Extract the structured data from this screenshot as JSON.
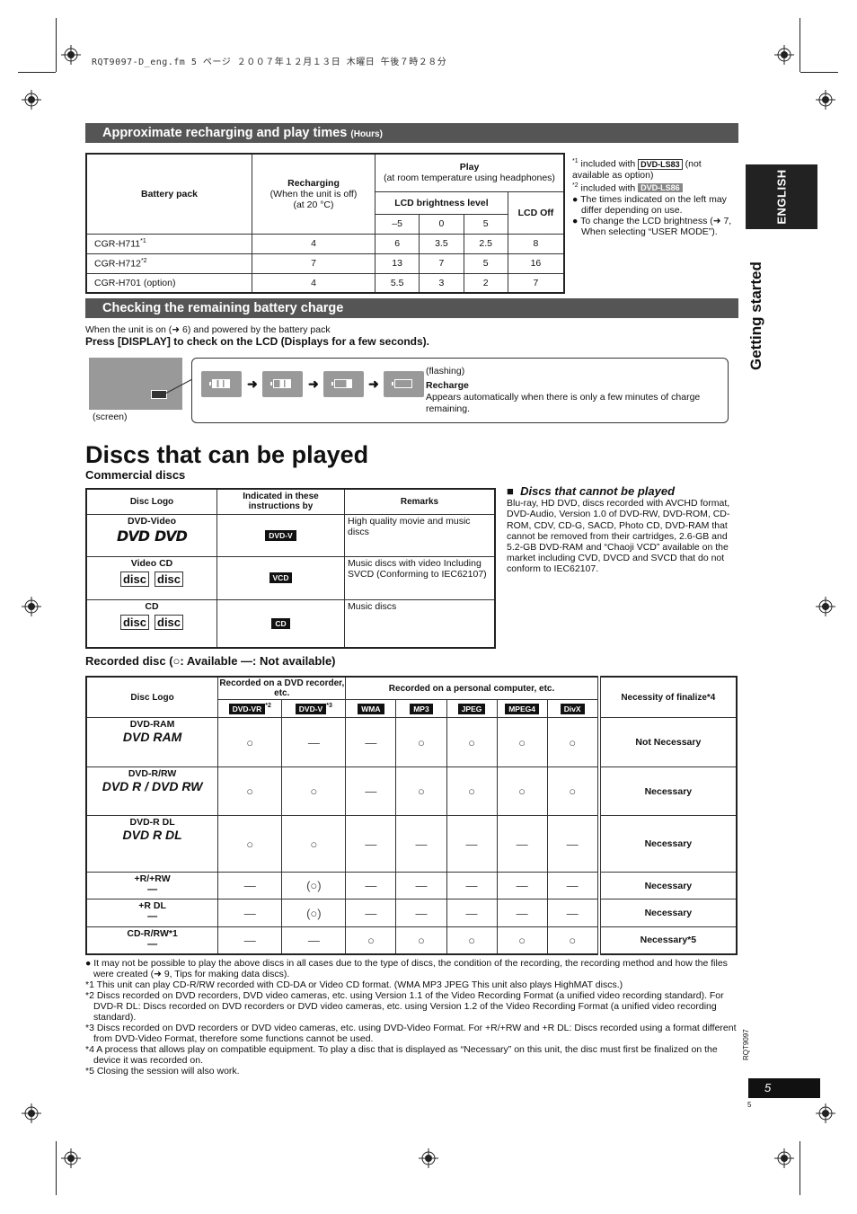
{
  "print_header": "RQT9097-D_eng.fm  5 ページ  ２００７年１２月１３日  木曜日  午後７時２８分",
  "side_tab": {
    "language": "ENGLISH",
    "chapter": "Getting started"
  },
  "section1": {
    "title": "Approximate recharging and play times",
    "title_suffix": "(Hours)",
    "table": {
      "h_battery": "Battery pack",
      "h_recharging": "Recharging",
      "h_recharging_sub1": "(When the unit is off)",
      "h_recharging_sub2": "(at 20 °C)",
      "h_play": "Play",
      "h_play_sub": "(at room temperature using headphones)",
      "h_lcd_level": "LCD brightness level",
      "h_lcd_off": "LCD Off",
      "levels": [
        "–5",
        "0",
        "5"
      ],
      "rows": [
        {
          "pack": "CGR-H711",
          "note": "*1",
          "recharge": "4",
          "m5": "6",
          "z": "3.5",
          "p5": "2.5",
          "off": "8"
        },
        {
          "pack": "CGR-H712",
          "note": "*2",
          "recharge": "7",
          "m5": "13",
          "z": "7",
          "p5": "5",
          "off": "16"
        },
        {
          "pack": "CGR-H701 (option)",
          "note": "",
          "recharge": "4",
          "m5": "5.5",
          "z": "3",
          "p5": "2",
          "off": "7"
        }
      ]
    },
    "notes": {
      "n1_mark": "*1",
      "n1_pre": "included with",
      "n1_badge": "DVD-LS83",
      "n1_post": "(not available as option)",
      "n2_mark": "*2",
      "n2_pre": "included with",
      "n2_badge": "DVD-LS86",
      "b1": "The times indicated on the left may differ depending on use.",
      "b2": "To change the LCD brightness (➜ 7, When selecting “USER MODE”)."
    }
  },
  "section2": {
    "title": "Checking the remaining battery charge",
    "intro": "When the unit is on (➜ 6) and powered by the battery pack",
    "instruction": "Press [DISPLAY] to check on the LCD (Displays for a few seconds).",
    "screen_label": "(screen)",
    "flashing": "(flashing)",
    "recharge_title": "Recharge",
    "recharge_desc": "Appears automatically when there is only a few minutes of charge remaining.",
    "arrow": "➜"
  },
  "discs": {
    "title": "Discs that can be played",
    "commercial_title": "Commercial discs",
    "commercial_headers": {
      "logo": "Disc Logo",
      "indicated": "Indicated in these instructions by",
      "remarks": "Remarks"
    },
    "commercial_rows": [
      {
        "name": "DVD-Video",
        "badge": "DVD-V",
        "remarks": "High quality movie and music discs"
      },
      {
        "name": "Video CD",
        "badge": "VCD",
        "remarks": "Music discs with video Including SVCD (Conforming to IEC62107)"
      },
      {
        "name": "CD",
        "badge": "CD",
        "remarks": "Music discs"
      }
    ],
    "cannot_title": "Discs that cannot be played",
    "cannot_text": "Blu-ray, HD DVD, discs recorded with AVCHD format, DVD-Audio, Version 1.0 of DVD-RW, DVD-ROM, CD-ROM, CDV, CD-G, SACD, Photo CD, DVD-RAM that cannot be removed from their cartridges, 2.6-GB and 5.2-GB DVD-RAM and “Chaoji VCD” available on the market including CVD, DVCD and SVCD that do not conform to IEC62107.",
    "recorded_title": "Recorded disc (○: Available —: Not available)",
    "recorded_headers": {
      "logo": "Disc Logo",
      "dvd_recorder": "Recorded on a DVD recorder, etc.",
      "pc": "Recorded on a personal computer, etc.",
      "finalize": "Necessity of finalize*4",
      "formats": [
        {
          "badge": "DVD-VR",
          "note": "*2"
        },
        {
          "badge": "DVD-V",
          "note": "*3"
        },
        {
          "badge": "WMA",
          "note": ""
        },
        {
          "badge": "MP3",
          "note": ""
        },
        {
          "badge": "JPEG",
          "note": ""
        },
        {
          "badge": "MPEG4",
          "note": ""
        },
        {
          "badge": "DivX",
          "note": ""
        }
      ]
    },
    "recorded_rows": [
      {
        "name": "DVD-RAM",
        "logo": "DVD RAM",
        "cells": [
          "○",
          "—",
          "—",
          "○",
          "○",
          "○",
          "○"
        ],
        "finalize": "Not Necessary"
      },
      {
        "name": "DVD-R/RW",
        "logo": "DVD R / DVD RW",
        "cells": [
          "○",
          "○",
          "—",
          "○",
          "○",
          "○",
          "○"
        ],
        "finalize": "Necessary"
      },
      {
        "name": "DVD-R DL",
        "logo": "DVD R DL",
        "cells": [
          "○",
          "○",
          "—",
          "—",
          "—",
          "—",
          "—"
        ],
        "finalize": "Necessary"
      },
      {
        "name": "+R/+RW",
        "logo": "—",
        "cells": [
          "—",
          "(○)",
          "—",
          "—",
          "—",
          "—",
          "—"
        ],
        "finalize": "Necessary"
      },
      {
        "name": "+R DL",
        "logo": "—",
        "cells": [
          "—",
          "(○)",
          "—",
          "—",
          "—",
          "—",
          "—"
        ],
        "finalize": "Necessary"
      },
      {
        "name": "CD-R/RW*1",
        "logo": "—",
        "cells": [
          "—",
          "—",
          "○",
          "○",
          "○",
          "○",
          "○"
        ],
        "finalize": "Necessary*5"
      }
    ]
  },
  "footnotes": [
    "● It may not be possible to play the above discs in all cases due to the type of discs, the condition of the recording, the recording method and how the files were created (➜ 9, Tips for making data discs).",
    "*1 This unit can play CD-R/RW recorded with CD-DA or Video CD format. (WMA MP3 JPEG This unit also plays HighMAT discs.)",
    "*2 Discs recorded on DVD recorders, DVD video cameras, etc. using Version 1.1 of the Video Recording Format (a unified video recording standard). For DVD-R DL: Discs recorded on DVD recorders or DVD video cameras, etc. using Version 1.2 of the Video Recording Format (a unified video recording standard).",
    "*3 Discs recorded on DVD recorders or DVD video cameras, etc. using DVD-Video Format. For +R/+RW and +R DL: Discs recorded using a format different from DVD-Video Format, therefore some functions cannot be used.",
    "*4 A process that allows play on compatible equipment. To play a disc that is displayed as “Necessary” on this unit, the disc must first be finalized on the device it was recorded on.",
    "*5 Closing the session will also work."
  ],
  "page": {
    "number": "5",
    "code": "RQT9097",
    "small_number": "5"
  }
}
